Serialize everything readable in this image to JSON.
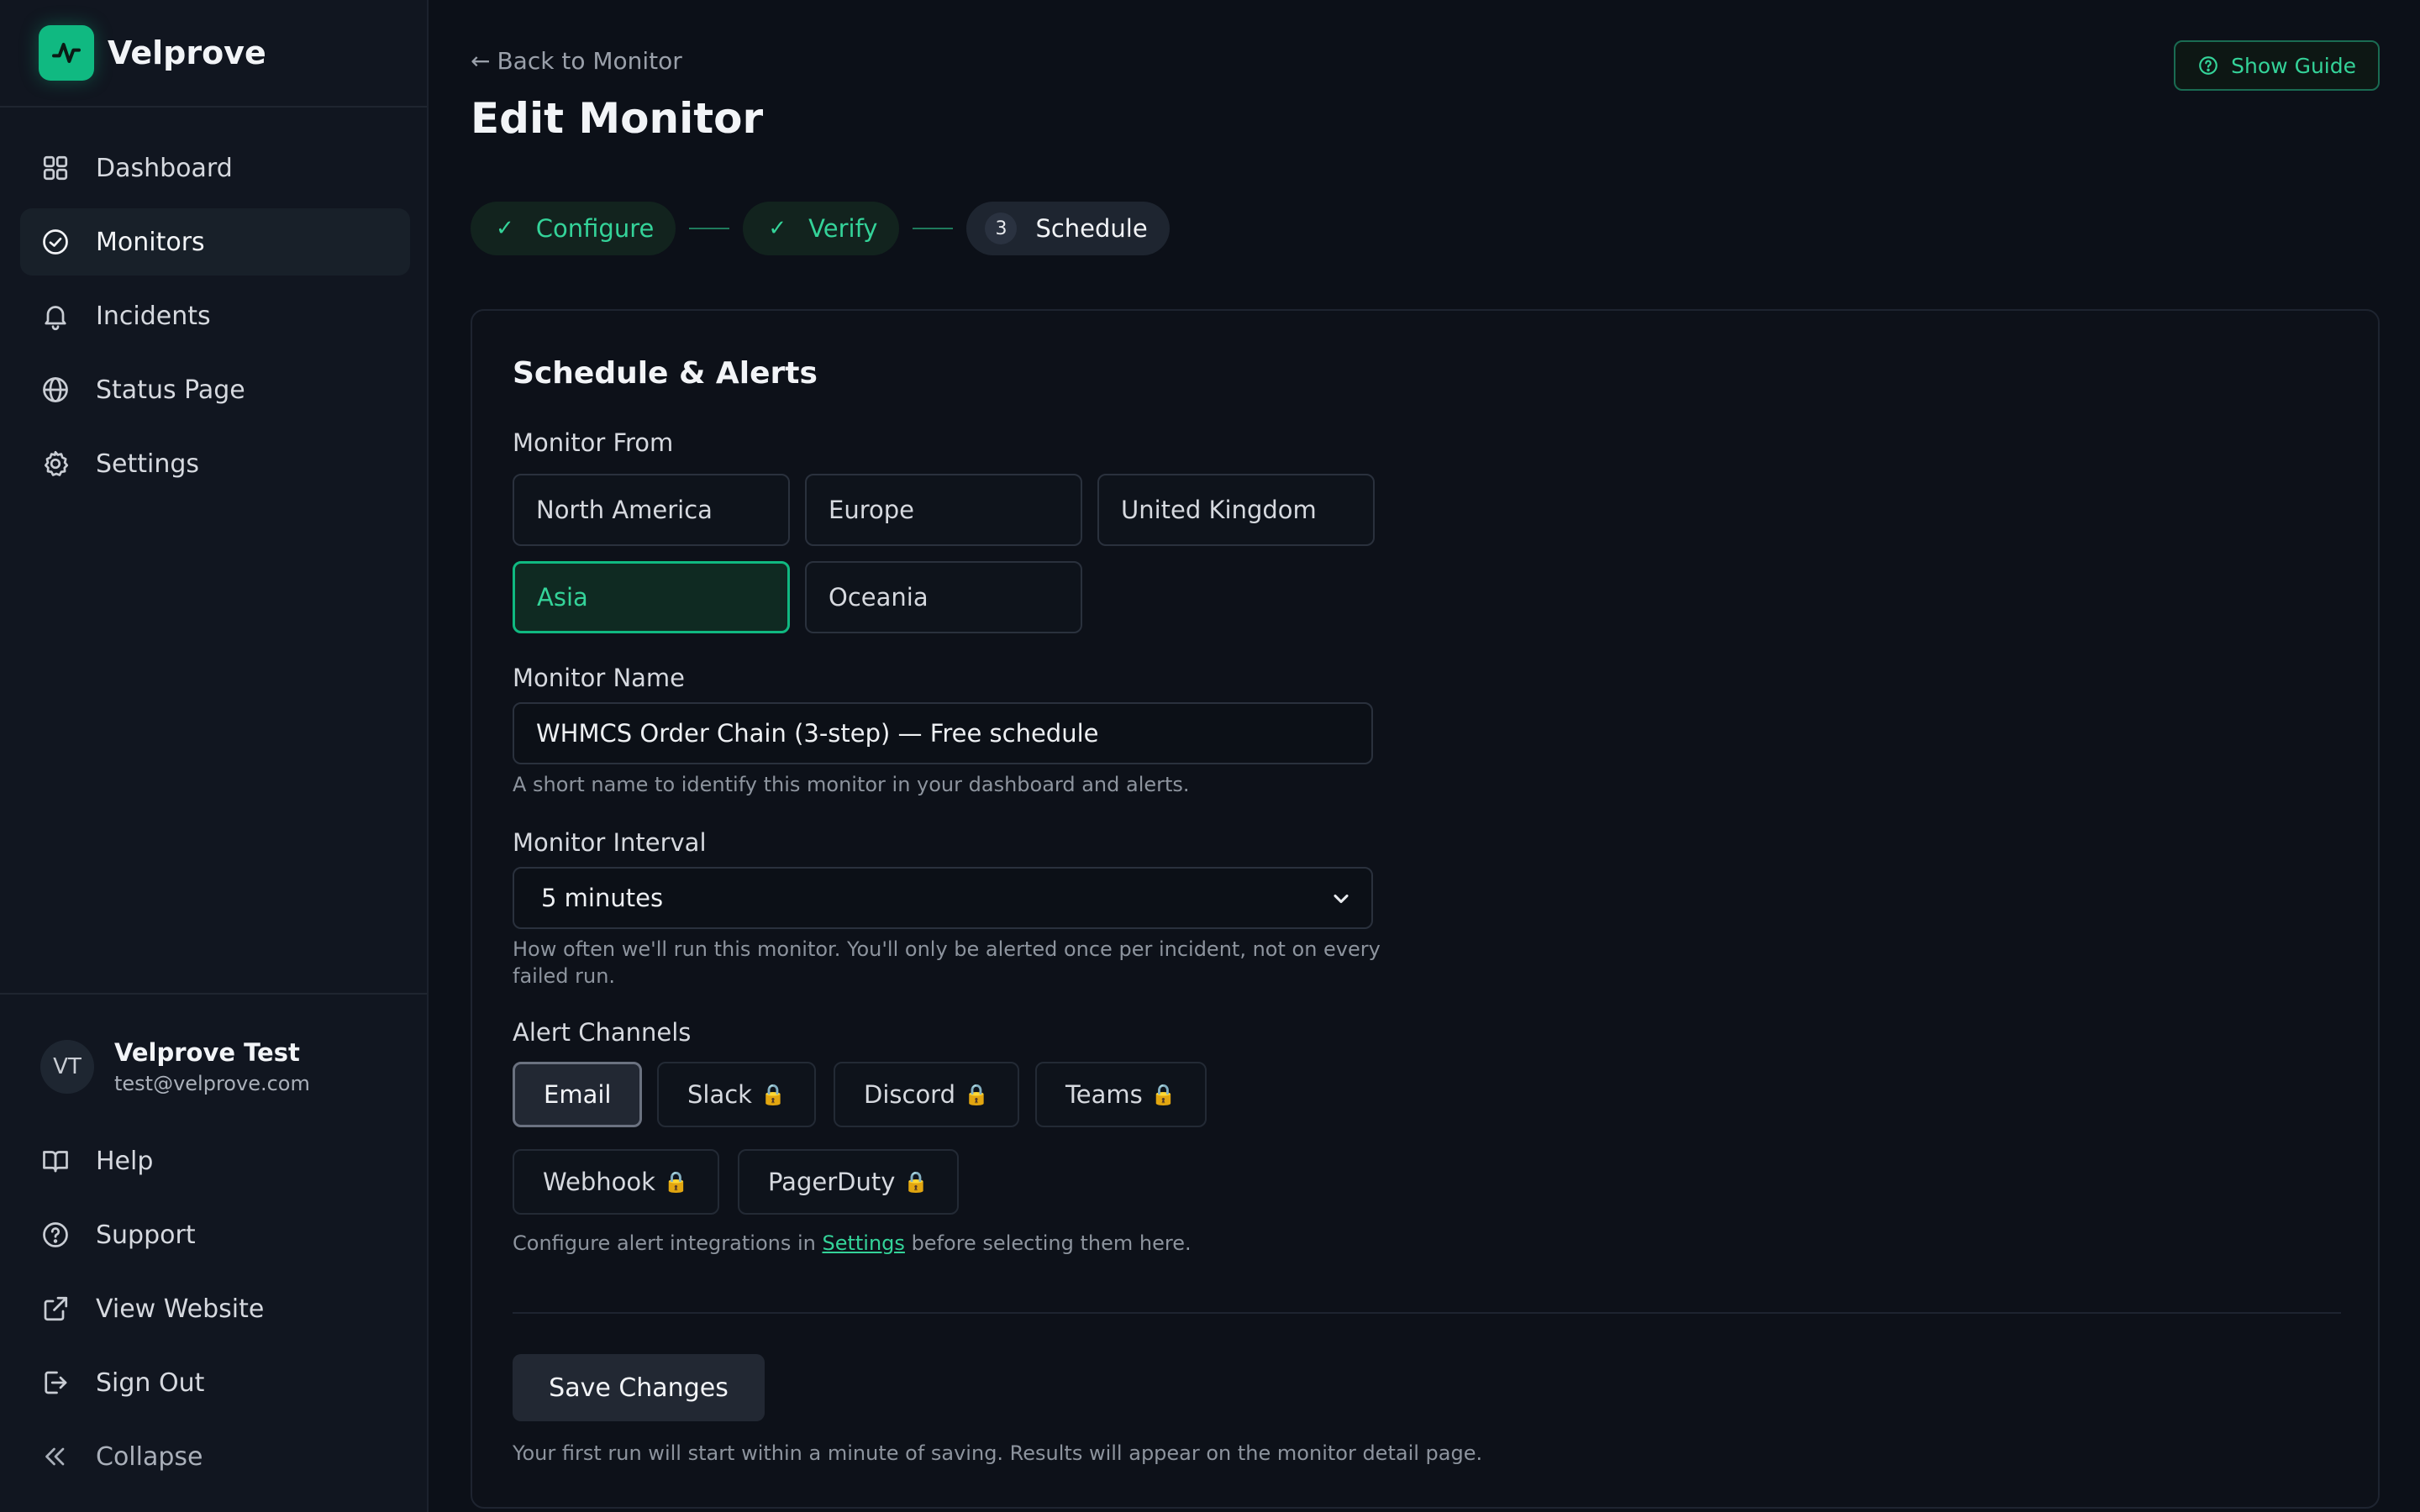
{
  "brand": {
    "name": "Velprove",
    "accent": "#10b981"
  },
  "sidebar": {
    "items": [
      {
        "label": "Dashboard",
        "icon": "grid-icon"
      },
      {
        "label": "Monitors",
        "icon": "check-circle-icon",
        "active": true
      },
      {
        "label": "Incidents",
        "icon": "bell-icon"
      },
      {
        "label": "Status Page",
        "icon": "globe-icon"
      },
      {
        "label": "Settings",
        "icon": "gear-icon"
      }
    ],
    "user": {
      "initials": "VT",
      "name": "Velprove Test",
      "email": "test@velprove.com"
    },
    "bottom_items": [
      {
        "label": "Help",
        "icon": "book-icon"
      },
      {
        "label": "Support",
        "icon": "question-circle-icon"
      },
      {
        "label": "View Website",
        "icon": "external-link-icon"
      },
      {
        "label": "Sign Out",
        "icon": "sign-out-icon"
      },
      {
        "label": "Collapse",
        "icon": "chevrons-left-icon"
      }
    ]
  },
  "header": {
    "back_label": "Back to Monitor",
    "back_arrow": "←",
    "title": "Edit Monitor",
    "guide_label": "Show Guide"
  },
  "stepper": {
    "steps": [
      {
        "label": "Configure",
        "status": "done",
        "mark": "✓"
      },
      {
        "label": "Verify",
        "status": "done",
        "mark": "✓"
      },
      {
        "label": "Schedule",
        "status": "current",
        "mark": "3"
      }
    ]
  },
  "form": {
    "section_title": "Schedule & Alerts",
    "monitor_from": {
      "label": "Monitor From",
      "options": [
        "North America",
        "Europe",
        "United Kingdom",
        "Asia",
        "Oceania"
      ],
      "selected": "Asia"
    },
    "monitor_name": {
      "label": "Monitor Name",
      "value": "WHMCS Order Chain (3-step) — Free schedule",
      "hint": "A short name to identify this monitor in your dashboard and alerts."
    },
    "interval": {
      "label": "Monitor Interval",
      "value": "5 minutes",
      "hint_line1": "How often we'll run this monitor. You'll only be alerted once per incident, not on every",
      "hint_line2": "failed run."
    },
    "alert_channels": {
      "label": "Alert Channels",
      "channels": [
        {
          "label": "Email",
          "locked": false,
          "selected": true
        },
        {
          "label": "Slack",
          "locked": true
        },
        {
          "label": "Discord",
          "locked": true
        },
        {
          "label": "Teams",
          "locked": true
        },
        {
          "label": "Webhook",
          "locked": true
        },
        {
          "label": "PagerDuty",
          "locked": true
        }
      ],
      "lock_glyph": "🔒",
      "hint_prefix": "Configure alert integrations in",
      "hint_link": "Settings",
      "hint_suffix": "before selecting them here."
    },
    "save_label": "Save Changes",
    "save_hint": "Your first run will start within a minute of saving. Results will appear on the monitor detail page."
  }
}
